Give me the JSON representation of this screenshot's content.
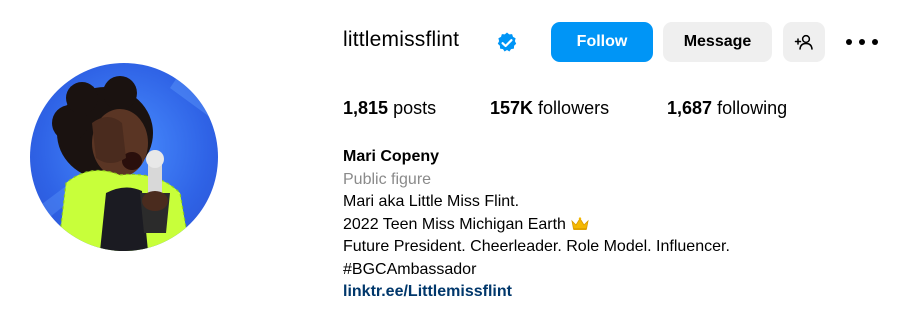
{
  "profile": {
    "username": "littlemissflint",
    "verified": true,
    "avatar_icon": "profile-photo"
  },
  "actions": {
    "follow_label": "Follow",
    "message_label": "Message",
    "add_user_icon": "person-plus-icon",
    "more_icon": "more-options-icon"
  },
  "stats": {
    "posts_count": "1,815",
    "posts_label": "posts",
    "followers_count": "157K",
    "followers_label": "followers",
    "following_count": "1,687",
    "following_label": "following"
  },
  "bio": {
    "full_name": "Mari Copeny",
    "category": "Public figure",
    "lines": [
      "Mari aka Little Miss Flint.",
      "2022 Teen Miss Michigan Earth",
      "Future President. Cheerleader. Role Model. Influencer.",
      "#BGCAmbassador"
    ],
    "crown_icon": "crown-emoji",
    "link": "linktr.ee/Littlemissflint"
  },
  "colors": {
    "primary_button": "#0095f6",
    "secondary_button": "#efefef",
    "muted_text": "#8a8a8a",
    "link_text": "#00376b",
    "verified_badge": "#0095f6"
  }
}
